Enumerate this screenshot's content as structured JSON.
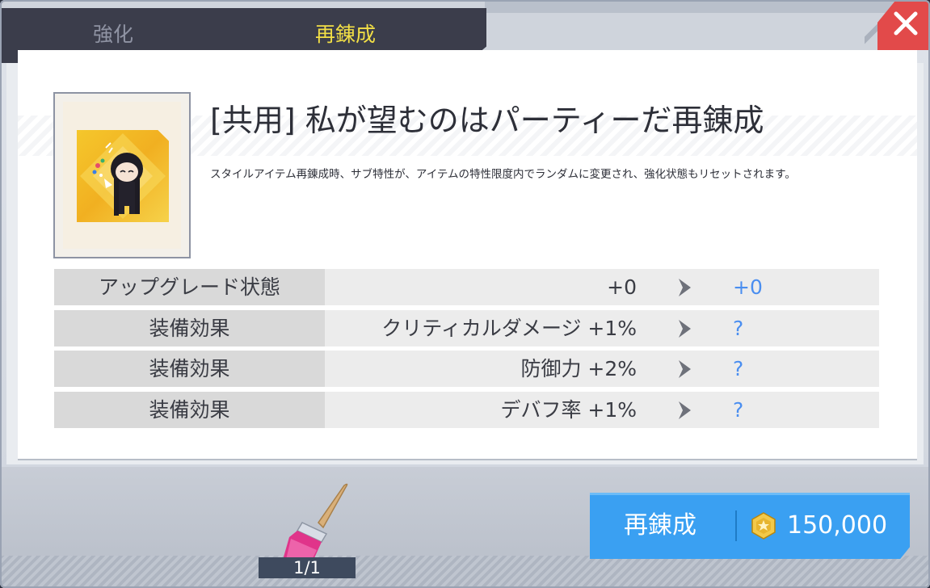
{
  "tabs": [
    {
      "label": "強化",
      "active": false
    },
    {
      "label": "再錬成",
      "active": true
    }
  ],
  "item": {
    "title": "[共用] 私が望むのはパーティーだ再錬成",
    "description": "スタイルアイテム再錬成時、サブ特性が、アイテムの特性限度内でランダムに変更され、強化状態もリセットされます。"
  },
  "stats": [
    {
      "label": "アップグレード状態",
      "current": "+0",
      "next": "+0"
    },
    {
      "label": "装備効果",
      "current": "クリティカルダメージ +1%",
      "next": "?"
    },
    {
      "label": "装備効果",
      "current": "防御力 +2%",
      "next": "?"
    },
    {
      "label": "装備効果",
      "current": "デバフ率 +1%",
      "next": "?"
    }
  ],
  "material": {
    "count": "1/1",
    "icon": "brush-icon"
  },
  "action": {
    "label": "再錬成",
    "cost": "150,000",
    "currency_icon": "coin-icon"
  },
  "colors": {
    "tab_active": "#f2df46",
    "next_value": "#4a8ef0",
    "button": "#3aa0f2",
    "close": "#e24a4a"
  }
}
